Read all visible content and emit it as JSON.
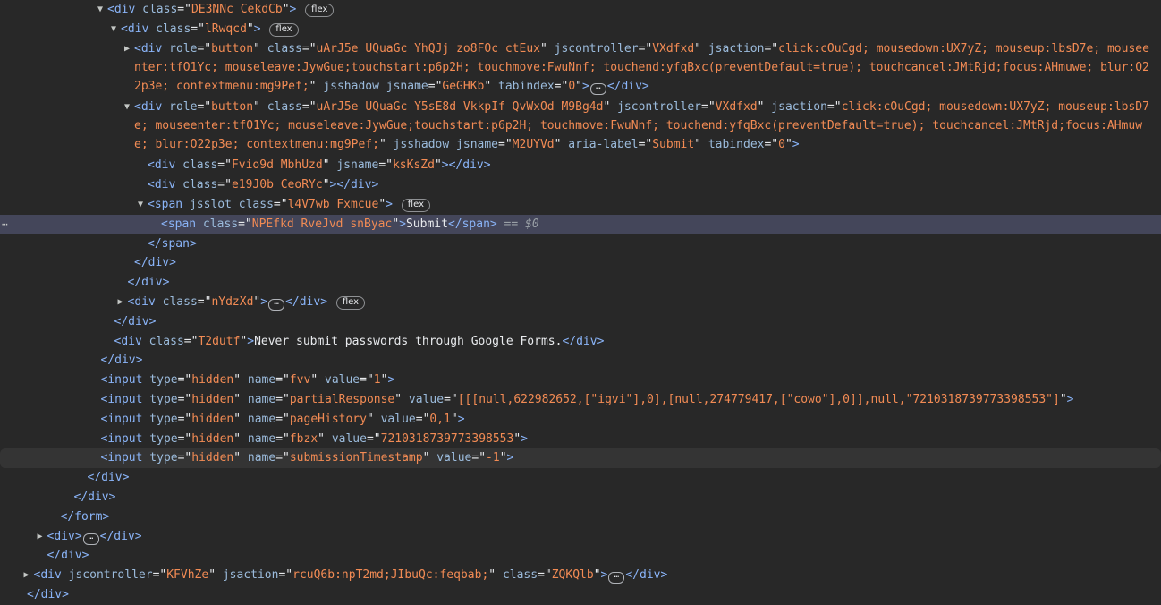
{
  "lines": [
    {
      "depth": 8,
      "arrow": "open",
      "tag": "div",
      "attrs": [
        [
          "class",
          "DE3NNc CekdCb"
        ]
      ],
      "suffix": ">",
      "pill": "flex"
    },
    {
      "depth": 9,
      "arrow": "open",
      "tag": "div",
      "attrs": [
        [
          "class",
          "lRwqcd"
        ]
      ],
      "suffix": ">",
      "pill": "flex"
    },
    {
      "depth": 10,
      "arrow": "closed",
      "tag": "div",
      "rows": 3,
      "attrs": [
        [
          "role",
          "button"
        ],
        [
          "class",
          "uArJ5e UQuaGc YhQJj zo8FOc ctEux"
        ],
        [
          "jscontroller",
          "VXdfxd"
        ],
        [
          "jsaction",
          "click:cOuCgd; mousedown:UX7yZ; mouseup:lbsD7e; mouseenter:tfO1Yc; mouseleave:JywGue;touchstart:p6p2H; touchmove:FwuNnf; touchend:yfqBxc(preventDefault=true); touchcancel:JMtRjd;focus:AHmuwe; blur:O22p3e; contextmenu:mg9Pef;"
        ],
        [
          "jsshadow",
          null
        ],
        [
          "jsname",
          "GeGHKb"
        ],
        [
          "tabindex",
          "0"
        ]
      ],
      "suffix": ">",
      "ellipsis": true,
      "close": "</div>"
    },
    {
      "depth": 10,
      "arrow": "open",
      "tag": "div",
      "rows": 3,
      "attrs": [
        [
          "role",
          "button"
        ],
        [
          "class",
          "uArJ5e UQuaGc Y5sE8d VkkpIf QvWxOd M9Bg4d"
        ],
        [
          "jscontroller",
          "VXdfxd"
        ],
        [
          "jsaction",
          "click:cOuCgd; mousedown:UX7yZ; mouseup:lbsD7e; mouseenter:tfO1Yc; mouseleave:JywGue;touchstart:p6p2H; touchmove:FwuNnf; touchend:yfqBxc(preventDefault=true); touchcancel:JMtRjd;focus:AHmuwe; blur:O22p3e; contextmenu:mg9Pef;"
        ],
        [
          "jsshadow",
          null
        ],
        [
          "jsname",
          "M2UYVd"
        ],
        [
          "aria-label",
          "Submit"
        ],
        [
          "tabindex",
          "0"
        ]
      ],
      "suffix": ">"
    },
    {
      "depth": 11,
      "tag": "div",
      "attrs": [
        [
          "class",
          "Fvio9d MbhUzd"
        ],
        [
          "jsname",
          "ksKsZd"
        ]
      ],
      "suffix": ">",
      "close": "</div>"
    },
    {
      "depth": 11,
      "tag": "div",
      "attrs": [
        [
          "class",
          "e19J0b CeoRYc"
        ]
      ],
      "suffix": ">",
      "close": "</div>"
    },
    {
      "depth": 11,
      "arrow": "open",
      "tag": "span",
      "attrs": [
        [
          "jsslot",
          null
        ],
        [
          "class",
          "l4V7wb Fxmcue"
        ]
      ],
      "suffix": ">",
      "pill": "flex"
    },
    {
      "depth": 12,
      "tag": "span",
      "attrs": [
        [
          "class",
          "NPEfkd RveJvd snByac"
        ]
      ],
      "suffix": ">",
      "text": "Submit",
      "close": "</span>",
      "extra": " == $0",
      "selected": true,
      "side": "⋯"
    },
    {
      "depth": 11,
      "raw": "</span>"
    },
    {
      "depth": 10,
      "raw": "</div>"
    },
    {
      "depth": 9.5,
      "raw": "</div>"
    },
    {
      "depth": 9.5,
      "arrow": "closed",
      "tag": "div",
      "attrs": [
        [
          "class",
          "nYdzXd"
        ]
      ],
      "suffix": ">",
      "ellipsis": true,
      "close": "</div>",
      "pill": "flex"
    },
    {
      "depth": 8.5,
      "raw": "</div>"
    },
    {
      "depth": 8.5,
      "tag": "div",
      "attrs": [
        [
          "class",
          "T2dutf"
        ]
      ],
      "suffix": ">",
      "text": "Never submit passwords through Google Forms.",
      "close": "</div>"
    },
    {
      "depth": 7.5,
      "raw": "</div>"
    },
    {
      "depth": 7.5,
      "tag": "input",
      "attrs": [
        [
          "type",
          "hidden"
        ],
        [
          "name",
          "fvv"
        ],
        [
          "value",
          "1"
        ]
      ],
      "suffix": ">"
    },
    {
      "depth": 7.5,
      "tag": "input",
      "attrs": [
        [
          "type",
          "hidden"
        ],
        [
          "name",
          "partialResponse"
        ],
        [
          "value",
          "[[[null,622982652,[\"igvi\"],0],[null,274779417,[\"cowo\"],0]],null,\"7210318739773398553\"]"
        ]
      ],
      "suffix": ">"
    },
    {
      "depth": 7.5,
      "tag": "input",
      "attrs": [
        [
          "type",
          "hidden"
        ],
        [
          "name",
          "pageHistory"
        ],
        [
          "value",
          "0,1"
        ]
      ],
      "suffix": ">"
    },
    {
      "depth": 7.5,
      "tag": "input",
      "attrs": [
        [
          "type",
          "hidden"
        ],
        [
          "name",
          "fbzx"
        ],
        [
          "value",
          "7210318739773398553"
        ]
      ],
      "suffix": ">"
    },
    {
      "depth": 7.5,
      "tag": "input",
      "attrs": [
        [
          "type",
          "hidden"
        ],
        [
          "name",
          "submissionTimestamp"
        ],
        [
          "value",
          "-1"
        ]
      ],
      "suffix": ">",
      "hover": true
    },
    {
      "depth": 6.5,
      "raw": "</div>"
    },
    {
      "depth": 5.5,
      "raw": "</div>"
    },
    {
      "depth": 4.5,
      "raw": "</form>"
    },
    {
      "depth": 3.5,
      "arrow": "closed",
      "tag": "div",
      "attrs": [],
      "suffix": ">",
      "ellipsis": true,
      "close": "</div>"
    },
    {
      "depth": 3.5,
      "raw": "</div>"
    },
    {
      "depth": 2.5,
      "arrow": "closed",
      "tag": "div",
      "attrs": [
        [
          "jscontroller",
          "KFVhZe"
        ],
        [
          "jsaction",
          "rcuQ6b:npT2md;JIbuQc:feqbab;"
        ],
        [
          "class",
          "ZQKQlb"
        ]
      ],
      "suffix": ">",
      "ellipsis": true,
      "close": "</div>"
    },
    {
      "depth": 2,
      "raw": "</div>"
    }
  ]
}
